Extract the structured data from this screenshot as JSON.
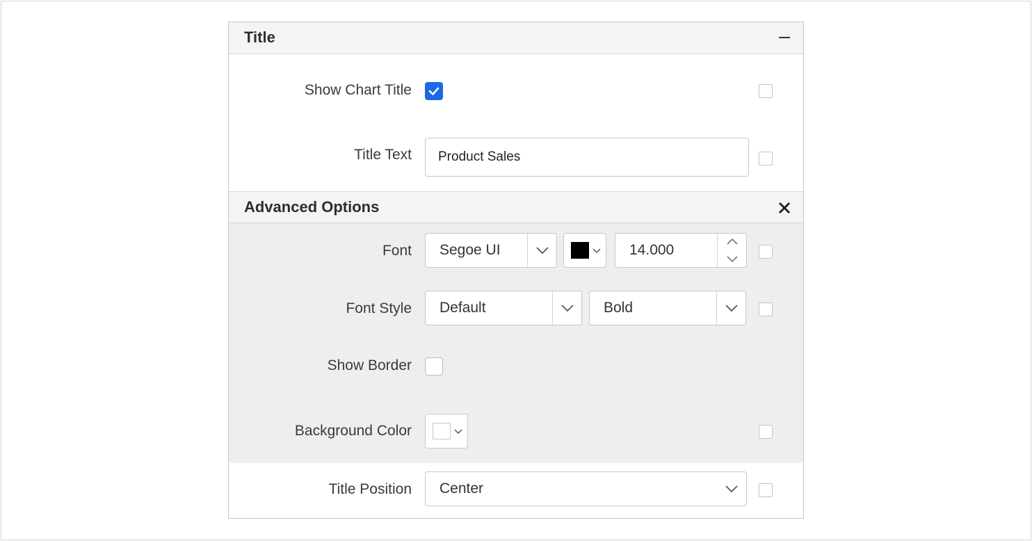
{
  "title_section": {
    "header": "Title"
  },
  "show_chart_title": {
    "label": "Show Chart Title",
    "checked": true
  },
  "title_text": {
    "label": "Title Text",
    "value": "Product Sales"
  },
  "advanced": {
    "header": "Advanced Options",
    "font": {
      "label": "Font",
      "family": "Segoe UI",
      "color": "#000000",
      "size": "14.000"
    },
    "font_style": {
      "label": "Font Style",
      "style": "Default",
      "weight": "Bold"
    },
    "show_border": {
      "label": "Show Border",
      "checked": false
    },
    "background_color": {
      "label": "Background Color",
      "color": "#ffffff"
    }
  },
  "title_position": {
    "label": "Title Position",
    "value": "Center"
  },
  "colors": {
    "accent": "#1c69e5",
    "panel_gray": "#eeeeee",
    "header_gray": "#f4f4f4"
  },
  "icons": [
    "minus-icon",
    "close-icon",
    "chevron-down-icon",
    "chevron-up-icon",
    "check-icon"
  ]
}
